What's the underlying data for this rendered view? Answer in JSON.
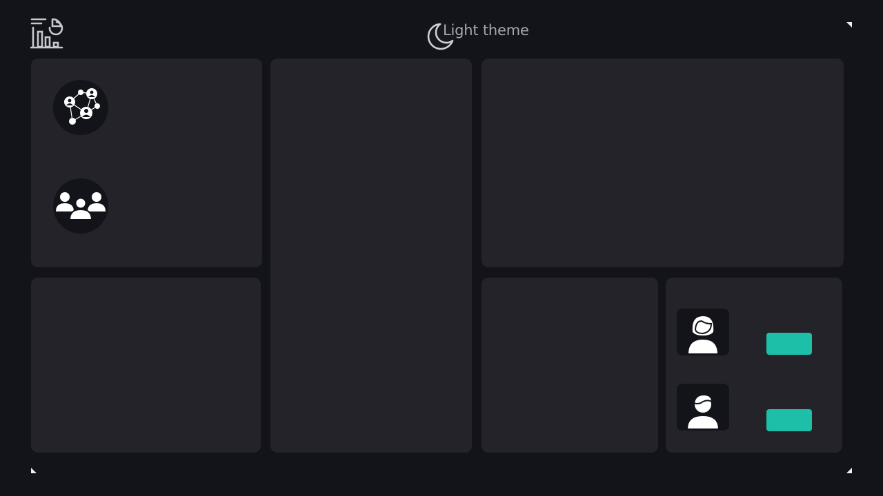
{
  "header": {
    "logo_icon": "analytics-chart-icon",
    "theme_toggle": {
      "icon": "moon-icon",
      "label": "Light theme"
    }
  },
  "colors": {
    "background": "#131419",
    "panel": "#232329",
    "accent": "#1dbfa8",
    "icon_fg": "#ffffff"
  },
  "panels": {
    "communities": {
      "items": [
        {
          "icon": "network-people-icon"
        },
        {
          "icon": "group-people-icon"
        }
      ]
    },
    "users": {
      "items": [
        {
          "icon": "female-user-icon"
        },
        {
          "icon": "male-user-icon"
        }
      ]
    }
  }
}
